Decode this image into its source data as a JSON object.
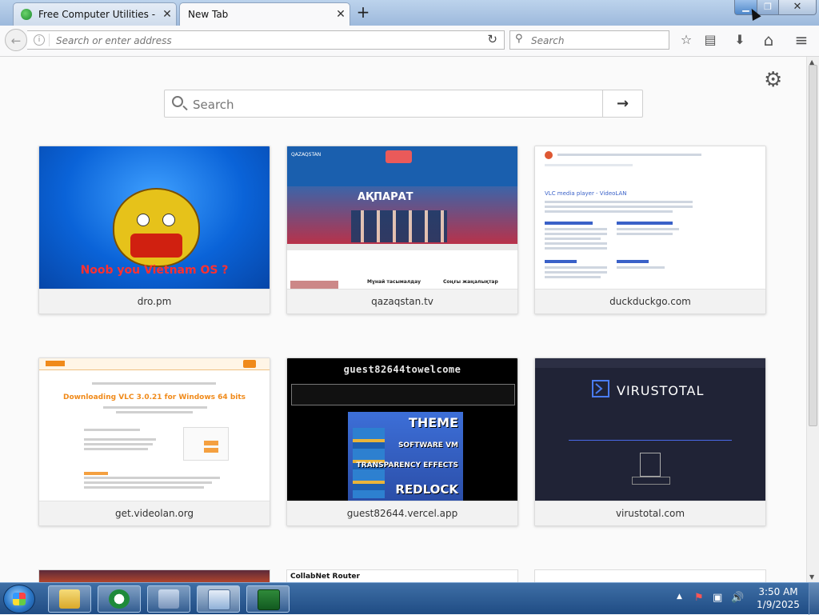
{
  "tabs": [
    {
      "title": "Free Computer Utilities - Do",
      "close": "✕"
    },
    {
      "title": "New Tab",
      "close": "✕"
    }
  ],
  "new_tab_glyph": "+",
  "window_controls": {
    "minimize": "▁",
    "maximize": "❐",
    "close": "✕"
  },
  "toolbar": {
    "back_glyph": "←",
    "url_placeholder": "Search or enter address",
    "url_value": "",
    "reload_glyph": "↻",
    "search_placeholder": "Search",
    "icons": [
      "bookmark-star-icon",
      "library-icon",
      "download-icon",
      "home-icon",
      "hamburger-menu-icon"
    ],
    "glyphs": {
      "star": "☆",
      "library": "▤",
      "download": "⬇",
      "home": "⌂",
      "menu": "≡"
    }
  },
  "newtab": {
    "search_placeholder": "Search",
    "go_glyph": "→",
    "settings_glyph": "⚙"
  },
  "tiles": [
    {
      "label": "dro.pm",
      "caption": "Noob you Vietnam OS ?"
    },
    {
      "label": "qazaqstan.tv",
      "brand": "QAZAQSTAN",
      "headline": "АҚПАРАТ",
      "sub1": "Мұнай тасымалдау",
      "sub2": "Соңғы жаңалықтар"
    },
    {
      "label": "duckduckgo.com",
      "result_title": "VLC media player - VideoLAN"
    },
    {
      "label": "get.videolan.org",
      "headline": "Downloading VLC 3.0.21 for Windows 64 bits"
    },
    {
      "label": "guest82644.vercel.app",
      "header": "guest82644towelcome",
      "w1": "THEME",
      "w2": "SOFTWARE VM",
      "w3": "TRANSPARENCY EFFECTS",
      "w4": "REDLOCK"
    },
    {
      "label": "virustotal.com",
      "brand": "VIRUSTOTAL"
    }
  ],
  "peek_tiles": [
    {
      "text": ""
    },
    {
      "text": "CollabNet Router"
    },
    {
      "text": ""
    }
  ],
  "taskbar": {
    "apps": [
      "file-explorer-icon",
      "ccleaner-icon",
      "system-security-icon",
      "remote-desktop-icon",
      "task-manager-icon"
    ],
    "clock_time": "3:50 AM",
    "clock_date": "1/9/2025",
    "tray": {
      "up": "▲",
      "flag": "⚑",
      "network": "▣",
      "volume": "🔊"
    }
  },
  "colors": {
    "accent": "#0a63d8",
    "taskbar": "#1f4c84"
  }
}
